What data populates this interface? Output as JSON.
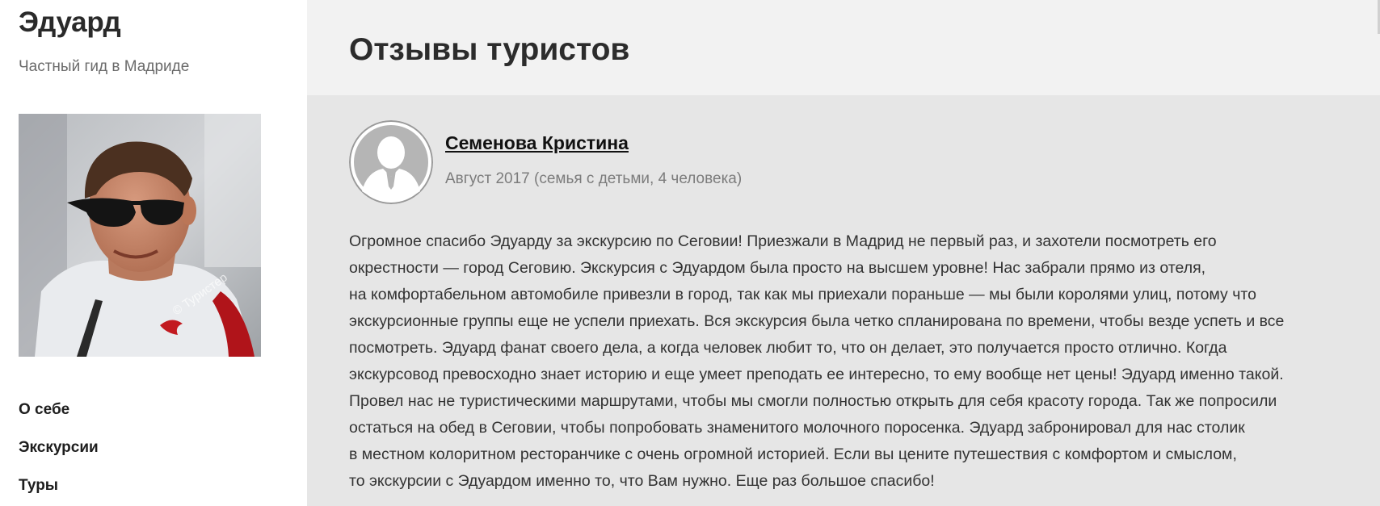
{
  "sidebar": {
    "site_title": "Эдуард",
    "site_subtitle": "Частный гид в Мадриде",
    "photo_watermark": "© Туристер",
    "nav": [
      {
        "label": "О себе"
      },
      {
        "label": "Экскурсии"
      },
      {
        "label": "Туры"
      }
    ]
  },
  "main": {
    "title": "Отзывы туристов",
    "review": {
      "author": "Семенова Кристина",
      "date": "Август 2017 (семья с детьми, 4 человека)",
      "text_lines": [
        "Огромное спасибо Эдуарду за экскурсию по Сеговии! Приезжали в Мадрид не первый раз, и захотели посмотреть его",
        "окрестности — город Сеговию. Экскурсия с Эдуардом была просто на высшем уровне! Нас забрали прямо из отеля,",
        "на комфортабельном автомобиле привезли в город, так как мы приехали пораньше — мы были королями улиц, потому что",
        "экскурсионные группы еще не успели приехать. Вся экскурсия была четко спланирована по времени, чтобы везде успеть и все",
        "посмотреть. Эдуард фанат своего дела, а когда человек любит то, что он делает, это получается просто отлично. Когда",
        "экскурсовод превосходно знает историю и еще умеет преподать ее интересно, то ему вообще нет цены! Эдуард именно такой.",
        "Провел нас не туристическими маршрутами, чтобы мы смогли полностью открыть для себя красоту города. Так же попросили",
        "остаться на обед в Сеговии, чтобы попробовать знаменитого молочного поросенка. Эдуард забронировал для нас столик",
        "в местном колоритном ресторанчике с очень огромной историей. Если вы цените путешествия с комфортом и смыслом,",
        "то экскурсии с Эдуардом именно то, что Вам нужно. Еще раз большое спасибо!"
      ]
    }
  },
  "icons": {
    "avatar": "user-placeholder-icon"
  },
  "colors": {
    "main_bg": "#e6e6e6",
    "header_bg": "#f2f2f2",
    "avatar_bg": "#b5b5b5"
  }
}
